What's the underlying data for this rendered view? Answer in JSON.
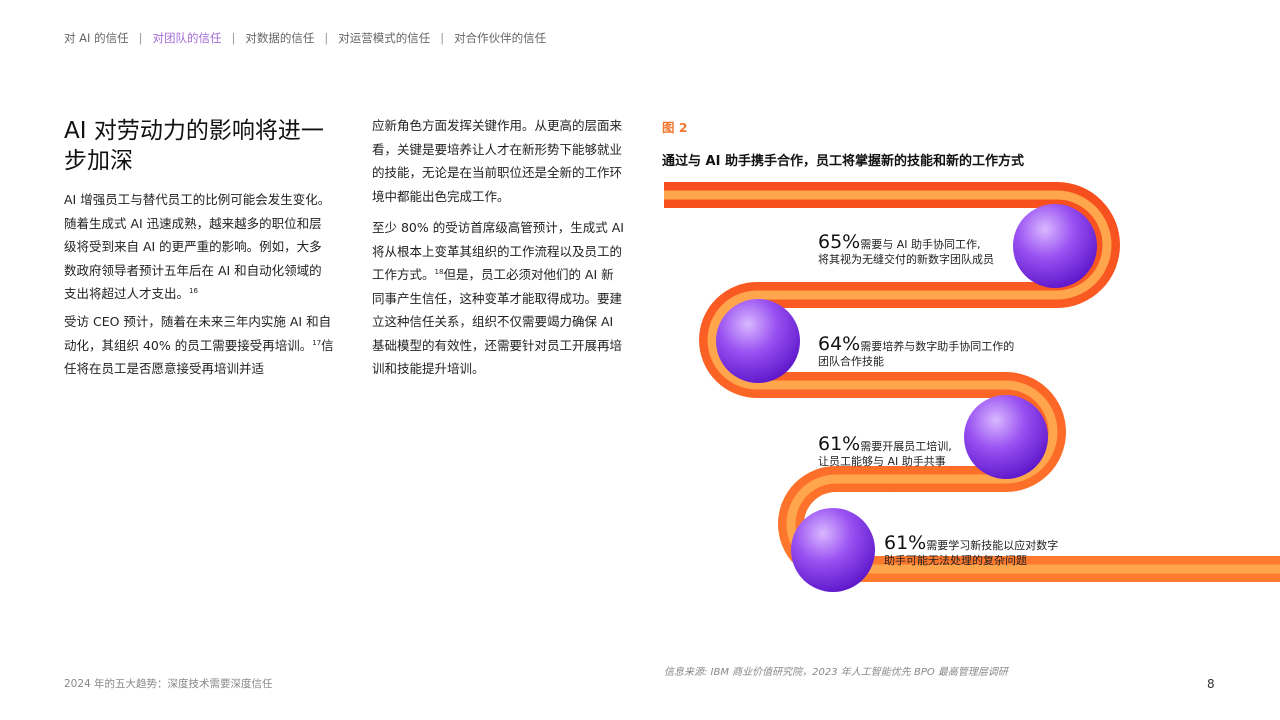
{
  "nav": {
    "items": [
      "对 AI 的信任",
      "对团队的信任",
      "对数据的信任",
      "对运营模式的信任",
      "对合作伙伴的信任"
    ],
    "separator": "|",
    "active_color": "#a36bd6"
  },
  "heading": "AI 对劳动力的影响将进一步加深",
  "col1": {
    "p1": "AI 增强员工与替代员工的比例可能会发生变化。随着生成式 AI 迅速成熟，越来越多的职位和层级将受到来自 AI 的更严重的影响。例如，大多数政府领导者预计五年后在 AI 和自动化领域的支出将超过人才支出。",
    "p1_ref": "16",
    "p2a": "受访 CEO 预计，随着在未来三年内实施 AI 和自动化，其组织 40% 的员工需要接受再培训。",
    "p2_ref": "17",
    "p2b": "信任将在员工是否愿意接受再培训并适"
  },
  "col2": {
    "p1": "应新角色方面发挥关键作用。从更高的层面来看，关键是要培养让人才在新形势下能够就业的技能，无论是在当前职位还是全新的工作环境中都能出色完成工作。",
    "p2a": "至少 80% 的受访首席级高管预计，生成式 AI 将从根本上变革其组织的工作流程以及员工的工作方式。",
    "p2_ref": "18",
    "p2b": "但是，员工必须对他们的 AI 新同事产生信任，这种变革才能取得成功。要建立这种信任关系，组织不仅需要竭力确保 AI 基础模型的有效性，还需要针对员工开展再培训和技能提升培训。"
  },
  "figure": {
    "label": "图 2",
    "title": "通过与 AI 助手携手合作，员工将掌握新的技能和新的工作方式",
    "stats": [
      {
        "pct": "65%",
        "text1": "需要与 AI 助手协同工作,",
        "text2": "将其视为无缝交付的新数字团队成员"
      },
      {
        "pct": "64%",
        "text1": "需要培养与数字助手协同工作的",
        "text2": "团队合作技能"
      },
      {
        "pct": "61%",
        "text1": "需要开展员工培训,",
        "text2": "让员工能够与 AI 助手共事"
      },
      {
        "pct": "61%",
        "text1": "需要学习新技能以应对数字",
        "text2": "助手可能无法处理的复杂问题"
      }
    ],
    "colors": {
      "path_outer": "#fa5a22",
      "path_inner": "#ffa64d",
      "sphere_light": "#d9b8ff",
      "sphere_dark": "#6a1fd6",
      "label": "#f2762e"
    },
    "source": "信息来源: IBM 商业价值研究院，2023 年人工智能优先 BPO 最高管理层调研"
  },
  "footer": "2024 年的五大趋势：深度技术需要深度信任",
  "page_number": "8"
}
